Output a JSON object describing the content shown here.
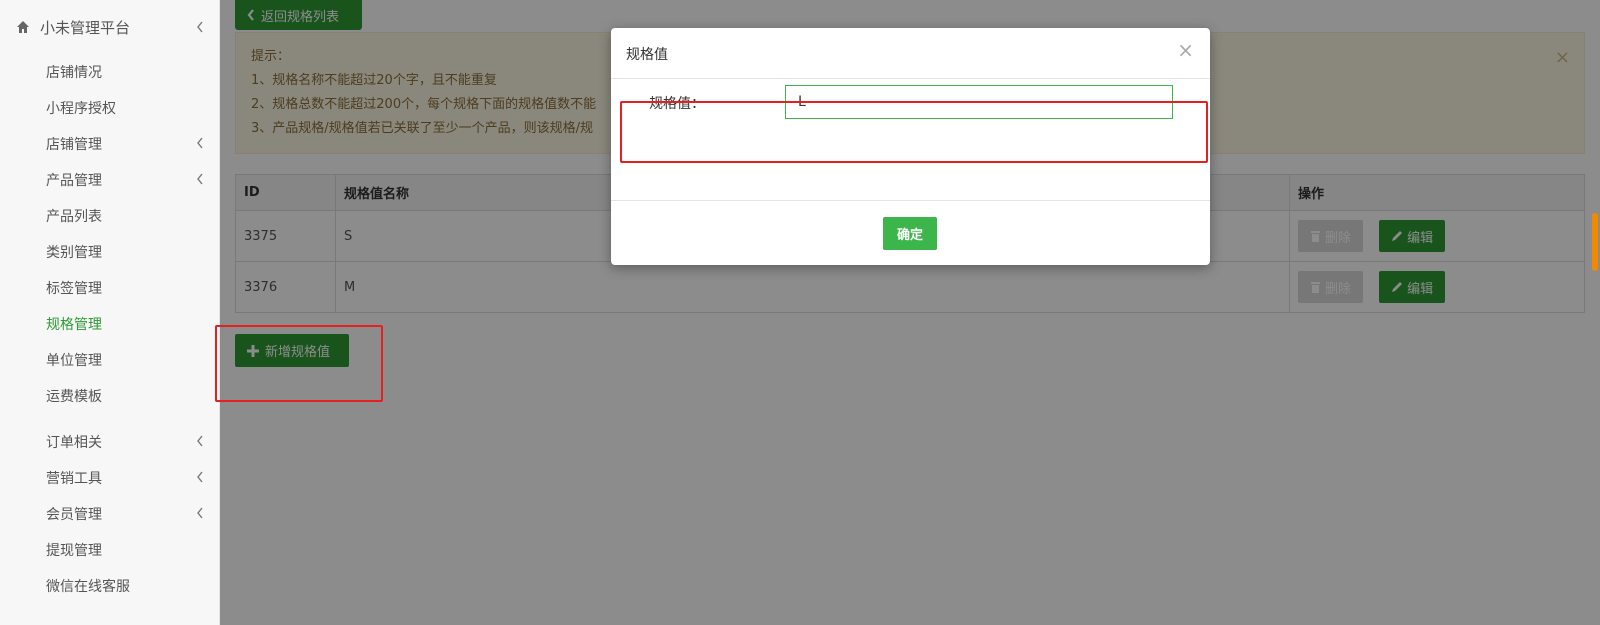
{
  "sidebar": {
    "brand": "小未管理平台",
    "items": [
      {
        "label": "店铺情况",
        "has_submenu": false,
        "active": false
      },
      {
        "label": "小程序授权",
        "has_submenu": false,
        "active": false
      },
      {
        "label": "店铺管理",
        "has_submenu": true,
        "active": false
      },
      {
        "label": "产品管理",
        "has_submenu": true,
        "active": false
      },
      {
        "label": "产品列表",
        "has_submenu": false,
        "active": false
      },
      {
        "label": "类别管理",
        "has_submenu": false,
        "active": false
      },
      {
        "label": "标签管理",
        "has_submenu": false,
        "active": false
      },
      {
        "label": "规格管理",
        "has_submenu": false,
        "active": true
      },
      {
        "label": "单位管理",
        "has_submenu": false,
        "active": false
      },
      {
        "label": "运费模板",
        "has_submenu": false,
        "active": false
      },
      {
        "label": "订单相关",
        "has_submenu": true,
        "active": false
      },
      {
        "label": "营销工具",
        "has_submenu": true,
        "active": false
      },
      {
        "label": "会员管理",
        "has_submenu": true,
        "active": false
      },
      {
        "label": "提现管理",
        "has_submenu": false,
        "active": false
      },
      {
        "label": "微信在线客服",
        "has_submenu": false,
        "active": false
      }
    ]
  },
  "main": {
    "back_label": "返回规格列表",
    "tips": {
      "title": "提示：",
      "lines": [
        "1、规格名称不能超过20个字，且不能重复",
        "2、规格总数不能超过200个，每个规格下面的规格值数不能",
        "3、产品规格/规格值若已关联了至少一个产品，则该规格/规"
      ],
      "close": "×"
    },
    "table": {
      "headers": [
        "ID",
        "规格值名称",
        "操作"
      ],
      "rows": [
        {
          "id": "3375",
          "name": "S"
        },
        {
          "id": "3376",
          "name": "M"
        }
      ],
      "delete_label": "删除",
      "edit_label": "编辑"
    },
    "add_label": "新增规格值"
  },
  "modal": {
    "title": "规格值",
    "close": "×",
    "field_label": "规格值：",
    "field_value": "L",
    "confirm_label": "确定"
  },
  "colors": {
    "primary_green": "#2f9a36",
    "input_green": "#3cb54a",
    "highlight_red": "#e62020",
    "active_nav": "#2f9a36"
  }
}
